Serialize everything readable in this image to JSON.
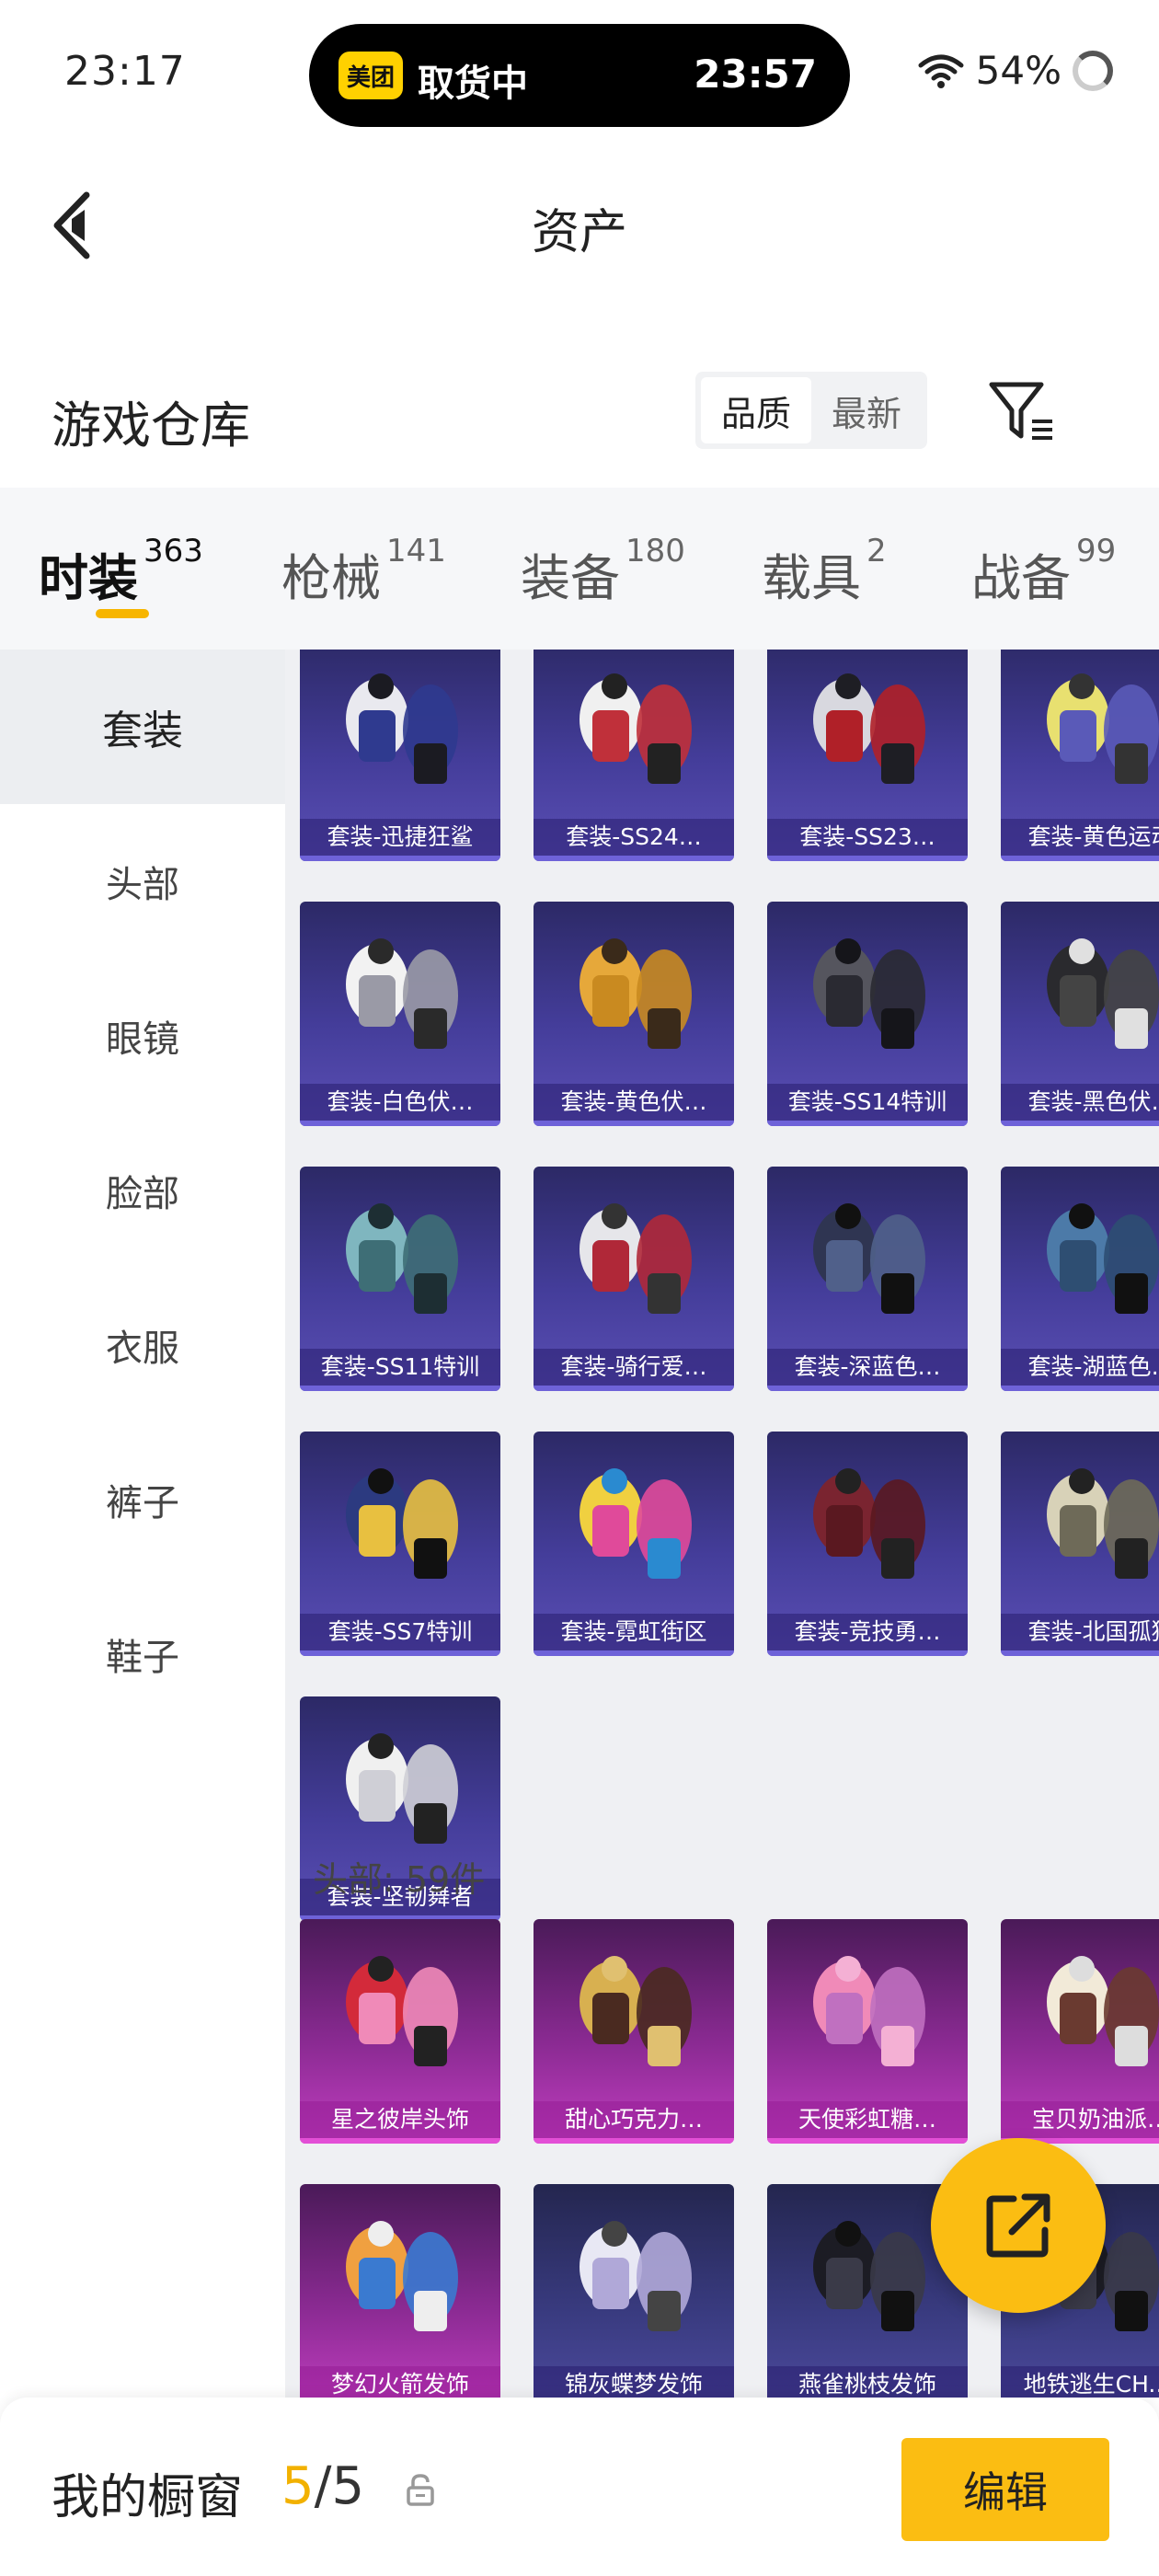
{
  "status_bar": {
    "time": "23:17",
    "island_app": "美团",
    "island_text": "取货中",
    "island_time": "23:57",
    "battery": "54%"
  },
  "header": {
    "title": "资产"
  },
  "section": {
    "title": "游戏仓库",
    "sort_options": [
      "品质",
      "最新"
    ],
    "active_sort": "品质"
  },
  "tabs": [
    {
      "label": "时装",
      "count": "363",
      "active": true
    },
    {
      "label": "枪械",
      "count": "141",
      "active": false
    },
    {
      "label": "装备",
      "count": "180",
      "active": false
    },
    {
      "label": "载具",
      "count": "2",
      "active": false
    },
    {
      "label": "战备",
      "count": "99",
      "active": false
    }
  ],
  "sidebar": {
    "items": [
      {
        "label": "套装",
        "active": true
      },
      {
        "label": "头部",
        "active": false
      },
      {
        "label": "眼镜",
        "active": false
      },
      {
        "label": "脸部",
        "active": false
      },
      {
        "label": "衣服",
        "active": false
      },
      {
        "label": "裤子",
        "active": false
      },
      {
        "label": "鞋子",
        "active": false
      }
    ]
  },
  "suits": [
    "套装-迅捷狂鲨",
    "套装-SS24…",
    "套装-SS23…",
    "套装-黄色运动",
    "套装-白色伏…",
    "套装-黄色伏…",
    "套装-SS14特训",
    "套装-黑色伏…",
    "套装-SS11特训",
    "套装-骑行爱…",
    "套装-深蓝色…",
    "套装-湖蓝色…",
    "套装-SS7特训",
    "套装-霓虹街区",
    "套装-竞技勇…",
    "套装-北国孤狼",
    "套装-坚韧舞者"
  ],
  "head_group": {
    "title": "头部: 59件",
    "items": [
      "星之彼岸头饰",
      "甜心巧克力…",
      "天使彩虹糖…",
      "宝贝奶油派…",
      "梦幻火箭发饰",
      "锦灰蝶梦发饰",
      "燕雀桃枝发饰",
      "地铁逃生CH.…"
    ]
  },
  "bottom_bar": {
    "label": "我的橱窗",
    "current": "5",
    "separator": "/",
    "total": "5",
    "edit_label": "编辑"
  },
  "icons": {
    "back": "chevron-left-icon",
    "filter": "filter-icon",
    "share": "share-external-icon",
    "lock": "lock-icon"
  },
  "colors": {
    "accent": "#fbbd12",
    "suit_card": "#443d9a",
    "head_card": "#a634a8"
  }
}
